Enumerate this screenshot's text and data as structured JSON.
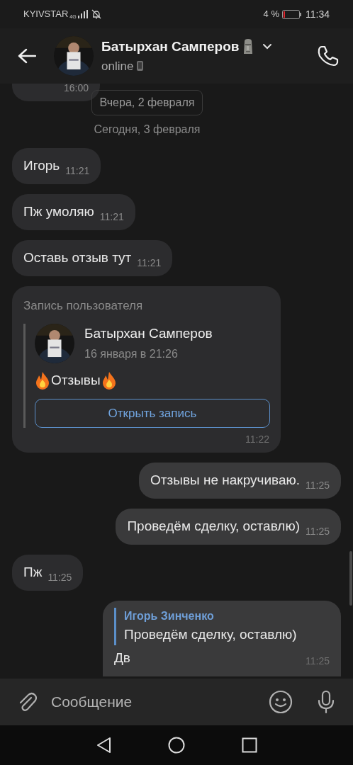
{
  "status_bar": {
    "carrier": "KYIVSTAR",
    "network": "4G",
    "battery_percent": "4 %",
    "time": "11:34"
  },
  "header": {
    "name": "Батырхан Самперов",
    "status": "online"
  },
  "messages": [
    {
      "kind": "text",
      "outgoing": false,
      "time": "16:00",
      "cut": true
    },
    {
      "kind": "date",
      "text": "Вчера, 2 февраля",
      "boxed": true
    },
    {
      "kind": "date",
      "text": "Сегодня, 3 февраля",
      "boxed": false
    },
    {
      "kind": "text",
      "outgoing": false,
      "text": "Игорь",
      "time": "11:21"
    },
    {
      "kind": "text",
      "outgoing": false,
      "text": "Пж умоляю",
      "time": "11:21"
    },
    {
      "kind": "text",
      "outgoing": false,
      "text": "Оставь отзыв тут",
      "time": "11:21"
    },
    {
      "kind": "post",
      "outgoing": false,
      "label": "Запись пользователя",
      "author": "Батырхан Самперов",
      "date": "16 января в 21:26",
      "text": "Отзывы",
      "button": "Открыть запись",
      "time": "11:22"
    },
    {
      "kind": "text",
      "outgoing": true,
      "text": "Отзывы не накручиваю.",
      "time": "11:25"
    },
    {
      "kind": "text",
      "outgoing": true,
      "text": "Проведём сделку, оставлю)",
      "time": "11:25"
    },
    {
      "kind": "text",
      "outgoing": false,
      "text": "Пж",
      "time": "11:25"
    },
    {
      "kind": "reply",
      "outgoing": true,
      "quote_author": "Игорь Зинченко",
      "quote_text": "Проведём сделку, оставлю)",
      "text": "Дв",
      "time": "11:25"
    }
  ],
  "composer": {
    "placeholder": "Сообщение"
  }
}
